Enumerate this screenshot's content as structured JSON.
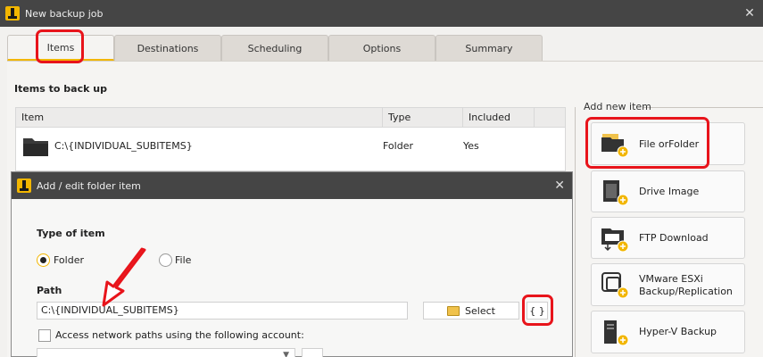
{
  "window": {
    "title": "New backup job",
    "close_glyph": "✕"
  },
  "tabs": [
    {
      "label": "Items",
      "active": true
    },
    {
      "label": "Destinations",
      "active": false
    },
    {
      "label": "Scheduling",
      "active": false
    },
    {
      "label": "Options",
      "active": false
    },
    {
      "label": "Summary",
      "active": false
    }
  ],
  "items_section": {
    "title": "Items to back up",
    "columns": [
      "Item",
      "Type",
      "Included"
    ],
    "rows": [
      {
        "item": "C:\\{INDIVIDUAL_SUBITEMS}",
        "type": "Folder",
        "included": "Yes",
        "icon": "folder-icon"
      }
    ]
  },
  "add_new_item": {
    "title": "Add new item",
    "buttons": [
      {
        "label": "File orFolder",
        "icon": "file-folder-icon"
      },
      {
        "label": "Drive Image",
        "icon": "drive-image-icon"
      },
      {
        "label": "FTP Download",
        "icon": "ftp-download-icon"
      },
      {
        "label": "VMware ESXi Backup/Replication",
        "line1": "VMware ESXi",
        "line2": "Backup/Replication",
        "icon": "vmware-icon"
      },
      {
        "label": "Hyper-V Backup",
        "icon": "hyperv-icon"
      }
    ]
  },
  "dialog": {
    "title": "Add / edit folder item",
    "close_glyph": "✕",
    "type_label": "Type of item",
    "radio_folder": "Folder",
    "radio_file": "File",
    "selected_type": "Folder",
    "path_label": "Path",
    "path_value": "C:\\{INDIVIDUAL_SUBITEMS}",
    "select_button": "Select",
    "variables_button": "{ }",
    "network_checkbox_label": "Access network paths using the following account:",
    "network_checked": false
  },
  "colors": {
    "accent": "#f2b600",
    "highlight": "#e8141b",
    "titlebar": "#454545"
  }
}
